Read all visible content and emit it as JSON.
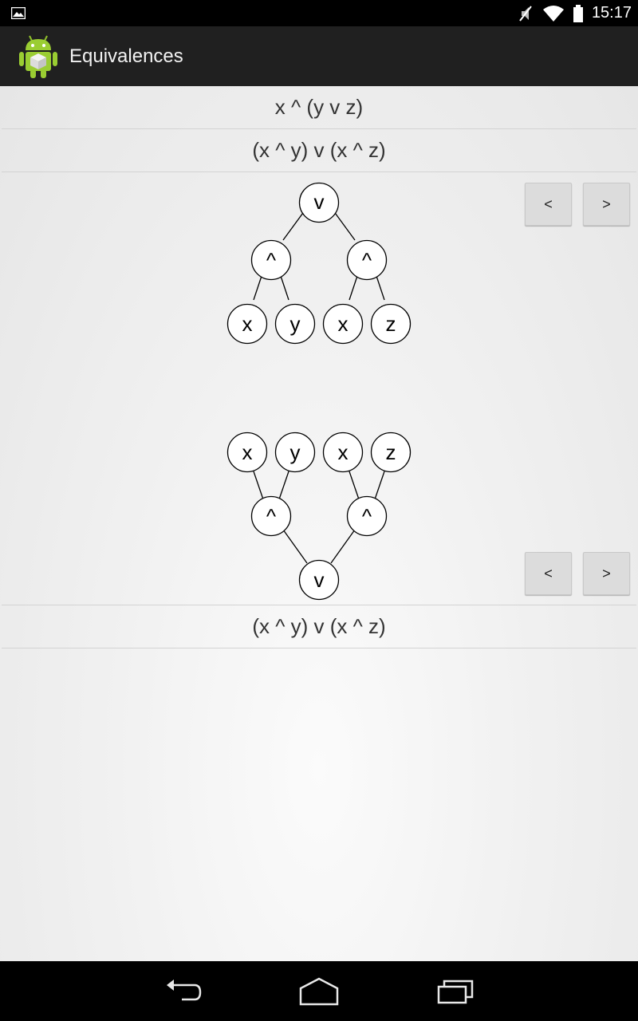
{
  "status_bar": {
    "time": "15:17",
    "icons": [
      "gallery-notification-icon",
      "mute-icon",
      "wifi-icon",
      "battery-icon"
    ]
  },
  "action_bar": {
    "title": "Equivalences",
    "icon": "android-app-icon"
  },
  "expressions": {
    "first": "x ^ (y v z)",
    "second": "(x ^ y) v (x ^ z)",
    "result": "(x ^ y) v (x ^ z)"
  },
  "top_tree": {
    "root": "v",
    "left_op": "^",
    "right_op": "^",
    "leaves": [
      "x",
      "y",
      "x",
      "z"
    ],
    "prev_label": "<",
    "next_label": ">"
  },
  "bottom_tree": {
    "root": "v",
    "left_op": "^",
    "right_op": "^",
    "leaves": [
      "x",
      "y",
      "x",
      "z"
    ],
    "prev_label": "<",
    "next_label": ">"
  },
  "nav_bar": {
    "icons": [
      "back-icon",
      "home-icon",
      "recent-apps-icon"
    ]
  }
}
